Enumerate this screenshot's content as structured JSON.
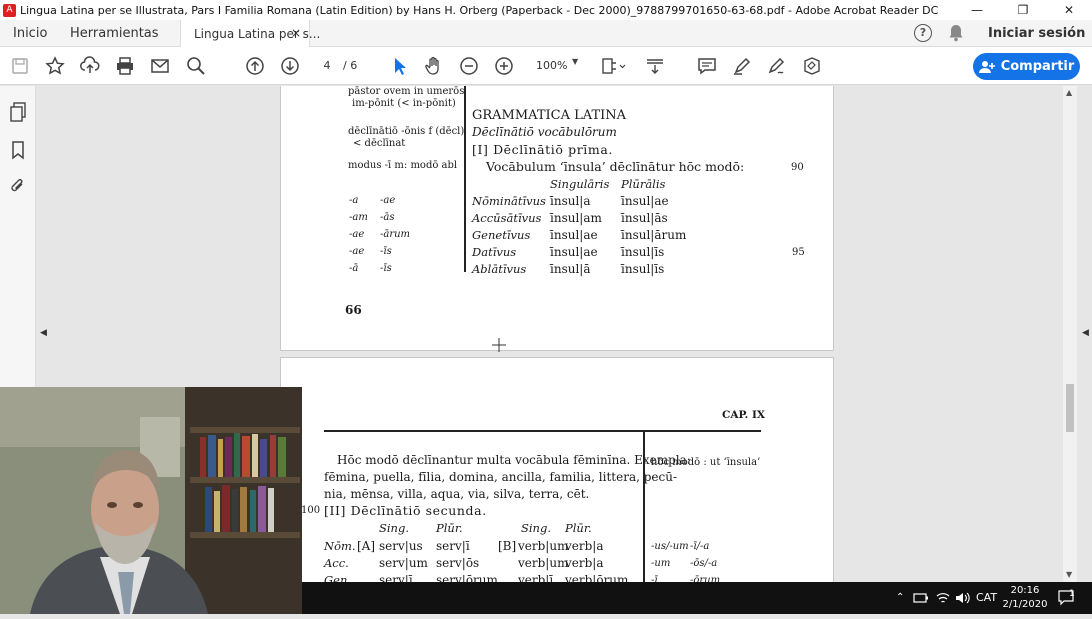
{
  "window": {
    "title": "Lingua Latina per se Illustrata, Pars I Familia Romana (Latin Edition) by Hans H. Orberg (Paperback - Dec 2000)_9788799701650-63-68.pdf - Adobe Acrobat Reader DC",
    "app_icon": "A",
    "minimize": "—",
    "maximize": "❐",
    "close": "✕"
  },
  "menu": {
    "home": "Inicio",
    "tools": "Herramientas",
    "doc_tab": "Lingua Latina per s...",
    "tab_close": "×",
    "help": "?",
    "signin": "Iniciar sesión"
  },
  "toolbar": {
    "page_current": "4",
    "page_total": "/ 6",
    "zoom": "100%",
    "share": "Compartir",
    "icons": [
      "save-icon",
      "bookmark-star-icon",
      "upload-icon",
      "print-icon",
      "email-icon",
      "search-zoom-icon",
      "page-up-icon",
      "page-down-icon",
      "select-cursor-icon",
      "hand-icon",
      "zoom-out-icon",
      "zoom-in-icon",
      "page-layout-icon",
      "scroll-mode-icon",
      "comment-icon",
      "highlight-icon",
      "sign-icon",
      "fill-sign-icon"
    ]
  },
  "page1": {
    "margin_notes": [
      "pāstor ovem in umerōs",
      "im-pōnit (< in-pōnit)",
      "dēclīnātiō -ōnis f (dēcl)",
      "< dēclīnat",
      "modus -ī m: modō abl"
    ],
    "ending_pairs": [
      [
        "-a",
        "-ae"
      ],
      [
        "-am",
        "-ās"
      ],
      [
        "-ae",
        "-ārum"
      ],
      [
        "-ae",
        "-īs"
      ],
      [
        "-ā",
        "-īs"
      ]
    ],
    "heading": "GRAMMATICA LATINA",
    "subheading": "Dēclīnātiō vocābulōrum",
    "section": "[I] Dēclīnātiō prīma.",
    "intro": "Vocābulum ‘īnsula’ dēclīnātur hōc modō:",
    "col_headers": [
      "Singulāris",
      "Plūrālis"
    ],
    "rows": [
      {
        "case": "Nōminātīvus",
        "sg": "īnsul|a",
        "pl": "īnsul|ae"
      },
      {
        "case": "Accūsātīvus",
        "sg": "īnsul|am",
        "pl": "īnsul|ās"
      },
      {
        "case": "Genetīvus",
        "sg": "īnsul|ae",
        "pl": "īnsul|ārum"
      },
      {
        "case": "Datīvus",
        "sg": "īnsul|ae",
        "pl": "īnsul|īs"
      },
      {
        "case": "Ablātīvus",
        "sg": "īnsul|ā",
        "pl": "īnsul|īs"
      }
    ],
    "line_numbers": [
      "90",
      "95"
    ],
    "page_number": "66"
  },
  "page2": {
    "chapter": "CAP. IX",
    "para_line1": "Hōc modō dēclīnantur multa vocābula fēminīna. Exempla:",
    "para_line2": "fēmina, puella, fīlia, domina, ancilla, familia, littera, pecū-",
    "para_line3": "nia, mēnsa, villa, aqua, via, silva, terra, cēt.",
    "line_number": "100",
    "section": "[II] Dēclīnātiō secunda.",
    "margin_note": "hōc modō : ut ‘īnsula’",
    "col_headers": [
      "Sing.",
      "Plūr.",
      "Sing.",
      "Plūr."
    ],
    "rows": [
      {
        "case": "Nōm.",
        "a_label": "[A]",
        "a_sg": "serv|us",
        "a_pl": "serv|ī",
        "b_label": "[B]",
        "b_sg": "verb|um",
        "b_pl": "verb|a"
      },
      {
        "case": "Acc.",
        "a_label": "",
        "a_sg": "serv|um",
        "a_pl": "serv|ōs",
        "b_label": "",
        "b_sg": "verb|um",
        "b_pl": "verb|a"
      },
      {
        "case": "Gen.",
        "a_label": "",
        "a_sg": "serv|ī",
        "a_pl": "serv|ōrum",
        "b_label": "",
        "b_sg": "verb|ī",
        "b_pl": "verb|ōrum"
      }
    ],
    "margin_endings": [
      [
        "-us/-um",
        "-ī/-a"
      ],
      [
        "-um",
        "-ōs/-a"
      ],
      [
        "-ī",
        "-ōrum"
      ]
    ]
  },
  "taskbar": {
    "language": "CAT",
    "time": "20:16",
    "date": "2/1/2020",
    "notifications": "1"
  }
}
